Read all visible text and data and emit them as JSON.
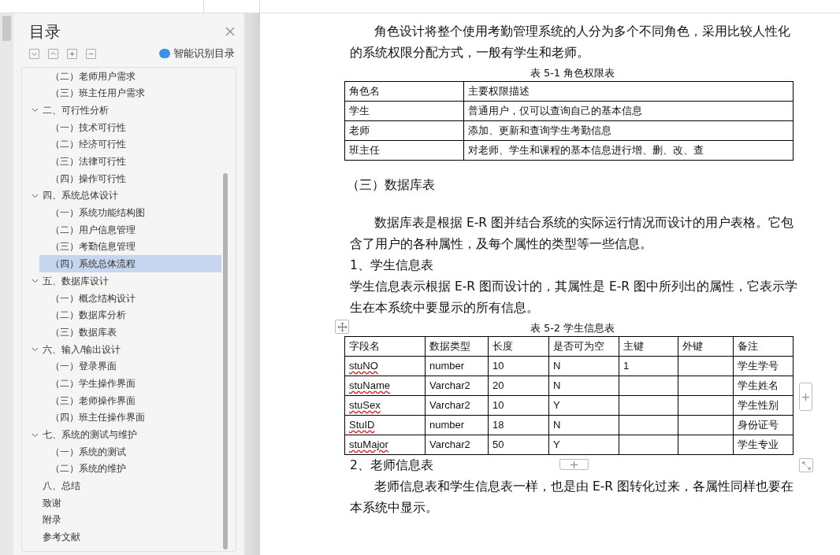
{
  "sidebar": {
    "title": "目录",
    "toolbar": [
      {
        "kind": "expand"
      },
      {
        "kind": "collapse"
      },
      {
        "kind": "plus"
      },
      {
        "kind": "minus"
      }
    ],
    "smart_button": "智能识别目录",
    "outline": {
      "continued_children": [
        {
          "label": "（二）老师用户需求",
          "selected": false
        },
        {
          "label": "（三）班主任用户需求",
          "selected": false
        }
      ],
      "items": [
        {
          "label": "二、可行性分析",
          "expanded": true,
          "selected": false,
          "children": [
            {
              "label": "（一）技术可行性",
              "selected": false
            },
            {
              "label": "（二）经济可行性",
              "selected": false
            },
            {
              "label": "（三）法律可行性",
              "selected": false
            },
            {
              "label": "（四）操作可行性",
              "selected": false
            }
          ]
        },
        {
          "label": "四、系统总体设计",
          "expanded": true,
          "selected": false,
          "children": [
            {
              "label": "（一）系统功能结构图",
              "selected": false
            },
            {
              "label": "（二）用户信息管理",
              "selected": false
            },
            {
              "label": "（三）考勤信息管理",
              "selected": false
            },
            {
              "label": "（四）系统总体流程",
              "selected": true
            }
          ]
        },
        {
          "label": "五、数据库设计",
          "expanded": true,
          "selected": false,
          "children": [
            {
              "label": "（一）概念结构设计",
              "selected": false
            },
            {
              "label": "（二）数据库分析",
              "selected": false
            },
            {
              "label": "（三）数据库表",
              "selected": false
            }
          ]
        },
        {
          "label": "六、输入/输出设计",
          "expanded": true,
          "selected": false,
          "children": [
            {
              "label": "（一）登录界面",
              "selected": false
            },
            {
              "label": "（二）学生操作界面",
              "selected": false
            },
            {
              "label": "（三）老师操作界面",
              "selected": false
            },
            {
              "label": "（四）班主任操作界面",
              "selected": false
            }
          ]
        },
        {
          "label": "七、系统的测试与维护",
          "expanded": true,
          "selected": false,
          "children": [
            {
              "label": "（一）系统的测试",
              "selected": false
            },
            {
              "label": "（二）系统的维护",
              "selected": false
            }
          ]
        },
        {
          "label": "八、总结",
          "selected": false
        },
        {
          "label": "致谢",
          "selected": false
        },
        {
          "label": "附录",
          "selected": false
        },
        {
          "label": "参考文献",
          "selected": false
        }
      ]
    }
  },
  "document": {
    "blocks": [
      {
        "kind": "para",
        "indent": true,
        "text": "角色设计将整个使用考勤管理系统的人分为多个不同角色，采用比较人性化的系统权限分配方式，一般有学生和老师。"
      },
      {
        "kind": "caption",
        "text": "表 5-1  角色权限表"
      },
      {
        "kind": "table",
        "rows": [
          [
            {
              "text": "角色名"
            },
            {
              "text": "主要权限描述"
            }
          ],
          [
            {
              "text": "学生"
            },
            {
              "text": "普通用户，仅可以查询自己的基本信息"
            }
          ],
          [
            {
              "text": "老师"
            },
            {
              "text": "添加、更新和查询学生考勤信息"
            }
          ],
          [
            {
              "text": "班主任"
            },
            {
              "text": "对老师、学生和课程的基本信息进行增、删、改、查"
            }
          ]
        ]
      },
      {
        "kind": "heading",
        "text": "（三）数据库表"
      },
      {
        "kind": "para",
        "indent": true,
        "text": "数据库表是根据 E-R 图并结合系统的实际运行情况而设计的用户表格。它包含了用户的各种属性，及每个属性的类型等一些信息。"
      },
      {
        "kind": "para",
        "indent": false,
        "text": "1、学生信息表"
      },
      {
        "kind": "para",
        "indent": false,
        "text": "学生信息表示根据 E-R 图而设计的，其属性是 E-R 图中所列出的属性，它表示学生在本系统中要显示的所有信息。"
      },
      {
        "kind": "caption",
        "text": "表 5-2  学生信息表"
      },
      {
        "kind": "table",
        "rows": [
          [
            {
              "text": "字段名"
            },
            {
              "text": "数据类型"
            },
            {
              "text": "长度"
            },
            {
              "text": "是否可为空"
            },
            {
              "text": "主键"
            },
            {
              "text": "外键"
            },
            {
              "text": "备注"
            }
          ],
          [
            {
              "text": "stuNO",
              "misspelled": true
            },
            {
              "text": "number"
            },
            {
              "text": "10"
            },
            {
              "text": "N"
            },
            {
              "text": "1"
            },
            {
              "text": ""
            },
            {
              "text": "学生学号"
            }
          ],
          [
            {
              "text": "stuName",
              "misspelled": true
            },
            {
              "text": "Varchar2"
            },
            {
              "text": "20"
            },
            {
              "text": "N"
            },
            {
              "text": ""
            },
            {
              "text": ""
            },
            {
              "text": "学生姓名"
            }
          ],
          [
            {
              "text": "stuSex",
              "misspelled": true
            },
            {
              "text": "Varchar2"
            },
            {
              "text": "10"
            },
            {
              "text": "Y"
            },
            {
              "text": ""
            },
            {
              "text": ""
            },
            {
              "text": "学生性别"
            }
          ],
          [
            {
              "text": "StuID",
              "misspelled": true
            },
            {
              "text": "number"
            },
            {
              "text": "18"
            },
            {
              "text": "N"
            },
            {
              "text": ""
            },
            {
              "text": ""
            },
            {
              "text": "身份证号"
            }
          ],
          [
            {
              "text": "stuMajor",
              "misspelled": true
            },
            {
              "text": "Varchar2"
            },
            {
              "text": "50"
            },
            {
              "text": "Y"
            },
            {
              "text": ""
            },
            {
              "text": ""
            },
            {
              "text": "学生专业"
            }
          ]
        ]
      },
      {
        "kind": "para",
        "indent": false,
        "text": "2、老师信息表"
      },
      {
        "kind": "para",
        "indent": true,
        "text": "老师信息表和学生信息表一样，也是由 E-R 图转化过来，各属性同样也要在本系统中显示。"
      }
    ]
  }
}
